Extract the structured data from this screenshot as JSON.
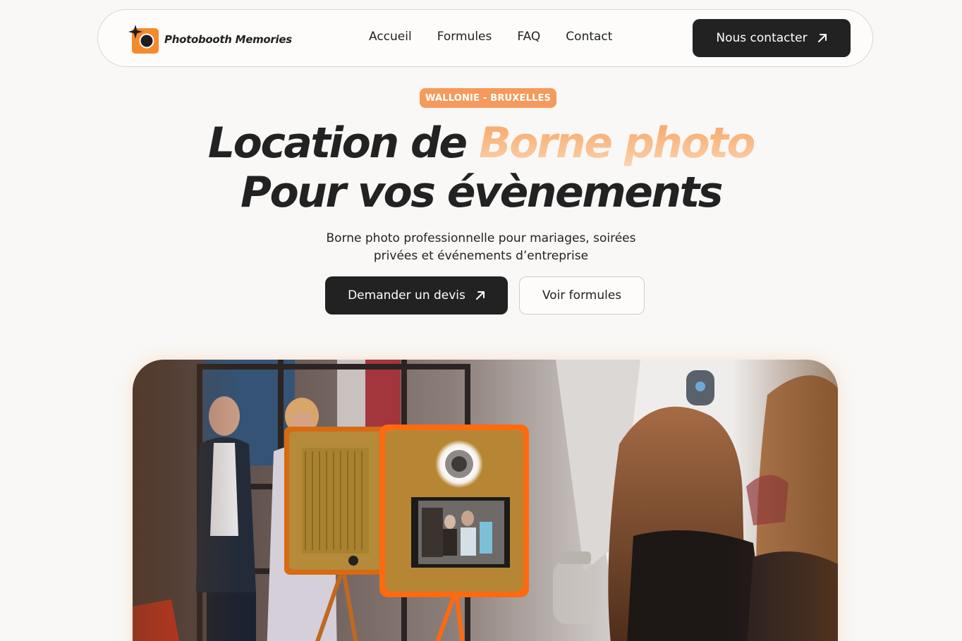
{
  "brand": {
    "name": "Photobooth Memories",
    "accent_color": "#f58a2c",
    "dark_color": "#222222"
  },
  "nav": {
    "links": [
      "Accueil",
      "Formules",
      "FAQ",
      "Contact"
    ],
    "cta_label": "Nous contacter",
    "cta_icon": "arrow-up-right-icon"
  },
  "hero": {
    "badge": "WALLONIE - BRUXELLES",
    "headline_part1": "Location de",
    "headline_accent": "Borne photo",
    "headline_line2": "Pour vos évènements",
    "subtitle": "Borne photo professionnelle pour mariages, soirées privées et événements d’entreprise",
    "primary_button": "Demander un devis",
    "secondary_button": "Voir formules"
  },
  "image": {
    "description_icon": "photo-booth-image"
  }
}
